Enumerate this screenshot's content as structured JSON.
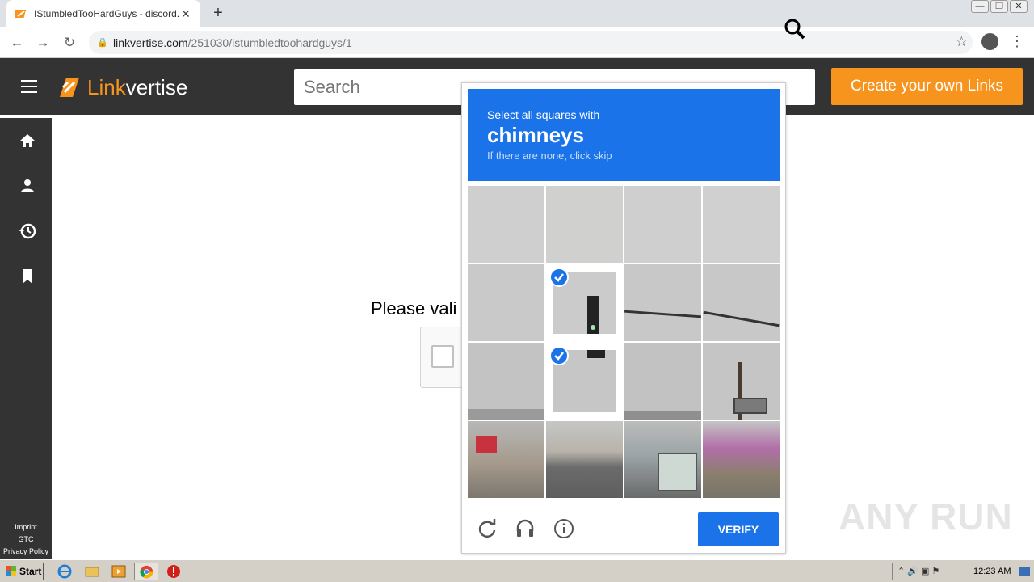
{
  "browser": {
    "tab_title": "IStumbledTooHardGuys - discord.gg",
    "tab_close": "✕",
    "new_tab": "+",
    "url_domain": "linkvertise.com",
    "url_path": "/251030/istumbledtoohardguys/1"
  },
  "site": {
    "logo_text_a": "Link",
    "logo_text_b": "vertise",
    "search_placeholder": "Search",
    "create_button": "Create your own Links",
    "footer_links": [
      "Imprint",
      "GTC",
      "Privacy Policy"
    ],
    "validate_text": "Please vali"
  },
  "captcha": {
    "prompt_line1": "Select all squares with",
    "prompt_object": "chimneys",
    "prompt_line3": "If there are none, click skip",
    "verify_label": "VERIFY",
    "selected_tiles": [
      5,
      9
    ]
  },
  "watermark": "ANY RUN",
  "taskbar": {
    "start_label": "Start",
    "clock": "12:23 AM"
  },
  "colors": {
    "captcha_blue": "#1a73e8",
    "linkvertise_orange": "#f7941d",
    "header_dark": "#333333"
  }
}
